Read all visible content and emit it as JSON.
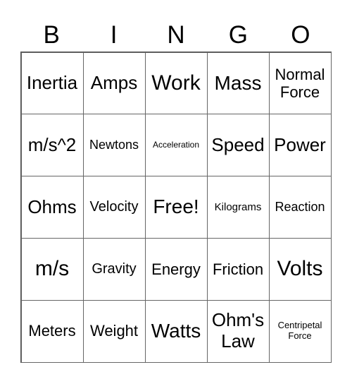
{
  "header": [
    "B",
    "I",
    "N",
    "G",
    "O"
  ],
  "cells": [
    [
      "Inertia",
      "Amps",
      "Work",
      "Mass",
      "Normal Force"
    ],
    [
      "m/s^2",
      "Newtons",
      "Acceleration",
      "Speed",
      "Power"
    ],
    [
      "Ohms",
      "Velocity",
      "Free!",
      "Kilograms",
      "Reaction"
    ],
    [
      "m/s",
      "Gravity",
      "Energy",
      "Friction",
      "Volts"
    ],
    [
      "Meters",
      "Weight",
      "Watts",
      "Ohm's Law",
      "Centripetal Force"
    ]
  ]
}
